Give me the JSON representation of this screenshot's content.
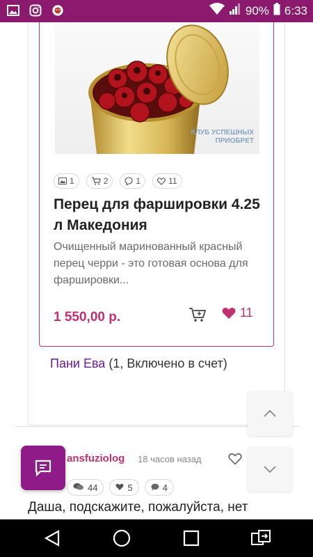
{
  "status_bar": {
    "battery": "90%",
    "time": "6:33",
    "icons": [
      "gallery-icon",
      "instagram-icon",
      "lion-icon",
      "wifi-icon",
      "signal-icon",
      "battery-icon"
    ]
  },
  "product": {
    "image_watermark": "КЛУБ УСПЕШНЫХ ПРИОБРЕТ",
    "stats": {
      "photos": "1",
      "carts": "2",
      "comments": "1",
      "likes": "11"
    },
    "title": "Перец для фаршировки 4.25 л Македония",
    "description": "Очищенный маринованный красный перец черри - это готовая основа для фаршировки...",
    "price": "1 550,00 р.",
    "like_count": "11"
  },
  "order": {
    "name": "Пани Ева",
    "info": " (1, Включено в счет)"
  },
  "comment": {
    "author": "ansfuziolog",
    "time": "18 часов назад",
    "stats": {
      "comments": "44",
      "likes": "5",
      "messages": "4"
    },
    "text": "Даша, подскажите, пожалуйста, нет"
  },
  "colors": {
    "brand": "#8b1a6f",
    "accent": "#c2306f",
    "link": "#6a1b9a"
  }
}
